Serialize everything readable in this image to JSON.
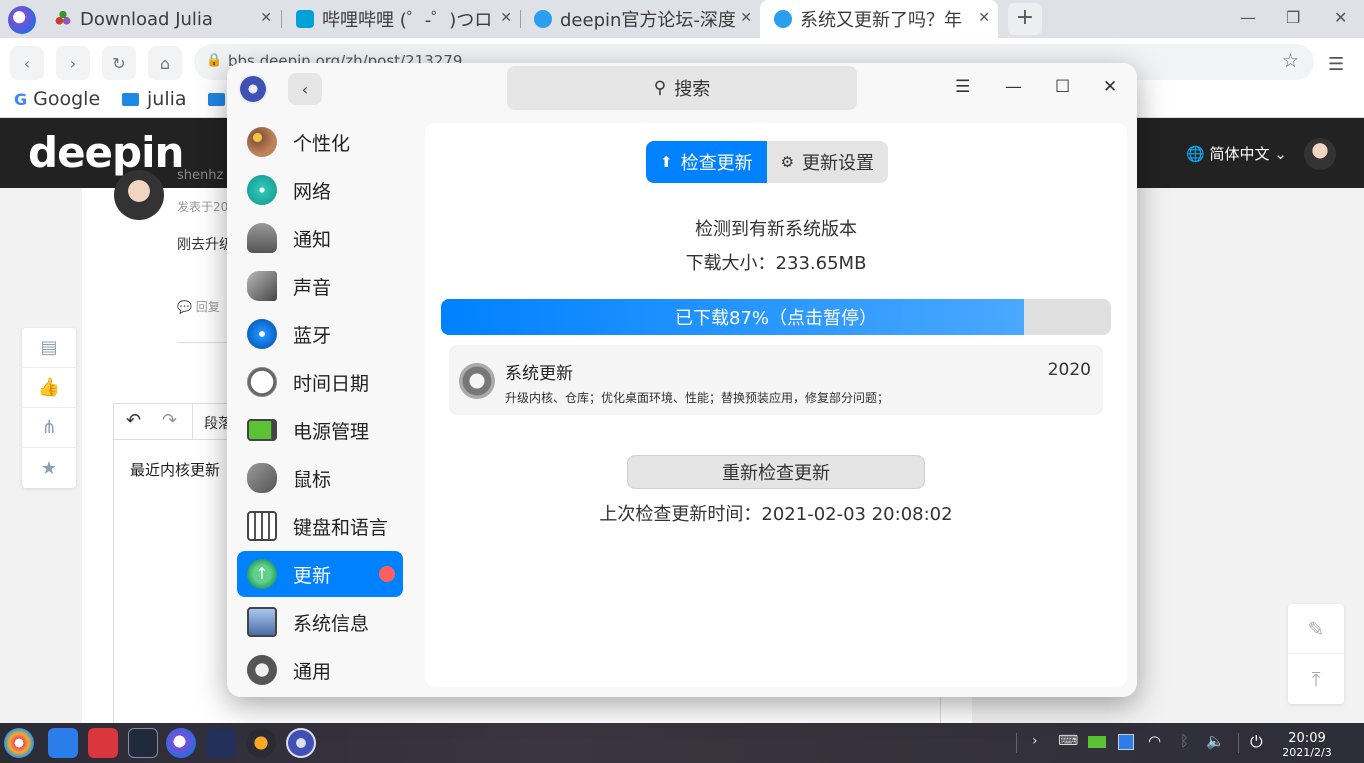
{
  "browser": {
    "tabs": [
      {
        "title": "Download Julia"
      },
      {
        "title": "哔哩哔哩 (゜-゜)つロ"
      },
      {
        "title": "deepin官方论坛-深度"
      },
      {
        "title": "系统又更新了吗？年"
      }
    ],
    "new_tab": "+",
    "url": "bbs.deepin.org/zh/post/213279",
    "bookmarks": [
      "Google",
      "julia"
    ]
  },
  "site": {
    "logo": "deepin",
    "language": "简体中文",
    "post_author": "shenhz",
    "post_date": "发表于20",
    "post_text": "刚去升级",
    "reply": "回复",
    "editor_paragraph": "段落",
    "editor_text": "最近内核更新"
  },
  "control_center": {
    "search_placeholder": "搜索",
    "sidebar": [
      {
        "label": "个性化",
        "color": "#8a5a3c"
      },
      {
        "label": "网络",
        "color": "#2ec4b6"
      },
      {
        "label": "通知",
        "color": "#777777"
      },
      {
        "label": "声音",
        "color": "#555555"
      },
      {
        "label": "蓝牙",
        "color": "#1e90ff"
      },
      {
        "label": "时间日期",
        "color": "#666666"
      },
      {
        "label": "电源管理",
        "color": "#5bc236"
      },
      {
        "label": "鼠标",
        "color": "#666666"
      },
      {
        "label": "键盘和语言",
        "color": "#555555"
      },
      {
        "label": "更新",
        "color": "#3cb371",
        "selected": true
      },
      {
        "label": "系统信息",
        "color": "#4a6fa5"
      },
      {
        "label": "通用",
        "color": "#555555"
      }
    ],
    "tabs": {
      "check": "检查更新",
      "settings": "更新设置"
    },
    "status": "检测到有新系统版本",
    "download_size": "下载大小：233.65MB",
    "progress": {
      "value": 0.87,
      "label": "已下载87%（点击暂停）"
    },
    "update_item": {
      "title": "系统更新",
      "version": "2020",
      "description": "升级内核、仓库；优化桌面环境、性能；替换预装应用，修复部分问题；"
    },
    "recheck_button": "重新检查更新",
    "last_check": "上次检查更新时间：2021-02-03 20:08:02"
  },
  "taskbar": {
    "time": "20:09",
    "date": "2021/2/3"
  }
}
